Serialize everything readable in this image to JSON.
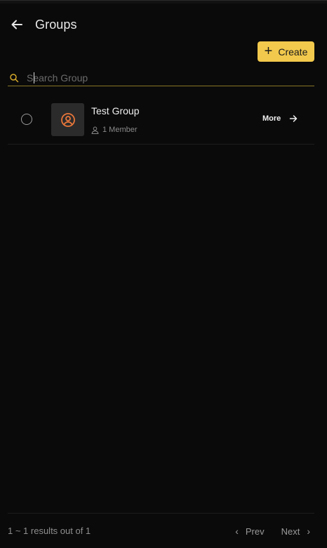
{
  "header": {
    "title": "Groups"
  },
  "toolbar": {
    "create_label": "Create"
  },
  "search": {
    "placeholder": "Search Group",
    "value": ""
  },
  "groups": [
    {
      "name": "Test Group",
      "members": "1 Member",
      "more_label": "More"
    }
  ],
  "footer": {
    "results_text": "1 ~ 1 results out of 1",
    "prev_label": "Prev",
    "next_label": "Next"
  },
  "colors": {
    "accent": "#f2c94c",
    "avatar_icon": "#e8763a",
    "background": "#0a0a0a"
  },
  "icons": {
    "back": "arrow-left-icon",
    "search": "search-icon",
    "avatar": "user-circle-icon",
    "member": "user-icon",
    "more": "arrow-right-icon"
  }
}
